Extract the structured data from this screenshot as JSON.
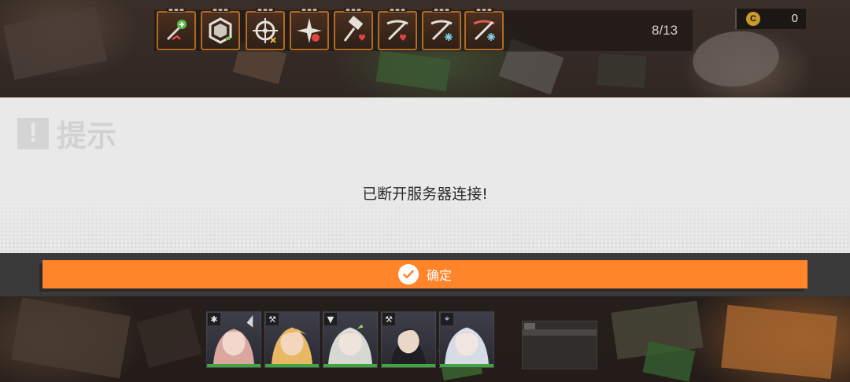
{
  "hud": {
    "skills": [
      {
        "icon": "healing-boost-icon"
      },
      {
        "icon": "shield-hexagon-icon"
      },
      {
        "icon": "crosshair-icon"
      },
      {
        "icon": "burst-star-icon"
      },
      {
        "icon": "hammer-heart-icon"
      },
      {
        "icon": "crossbow-heart-icon"
      },
      {
        "icon": "crossbow-frost-icon"
      },
      {
        "icon": "crossbow-frost-red-icon"
      }
    ],
    "counter": "8/13",
    "currency": {
      "icon": "coin-icon",
      "symbol": "C",
      "amount": "0"
    }
  },
  "dialog": {
    "title": "提示",
    "title_icon": "!",
    "message": "已断开服务器连接!",
    "confirm_label": "确定"
  },
  "team": {
    "members": [
      {
        "class_icon": "✱",
        "hair": "#d9a7a0",
        "tone": "#f2d8cc"
      },
      {
        "class_icon": "⚒",
        "hair": "#e8b865",
        "tone": "#f3d6bd"
      },
      {
        "class_icon": "▼",
        "hair": "#d8d8d2",
        "tone": "#efe4dc"
      },
      {
        "class_icon": "⚒",
        "hair": "#2a2a30",
        "tone": "#ead7c8"
      },
      {
        "class_icon": "⌖",
        "hair": "#d6dbe6",
        "tone": "#f1e6e0"
      }
    ]
  },
  "colors": {
    "accent": "#ff842a",
    "dialog_bg": "#e9e9e9",
    "hp_bar": "#3fa83a",
    "skill_border": "#b46a22"
  }
}
